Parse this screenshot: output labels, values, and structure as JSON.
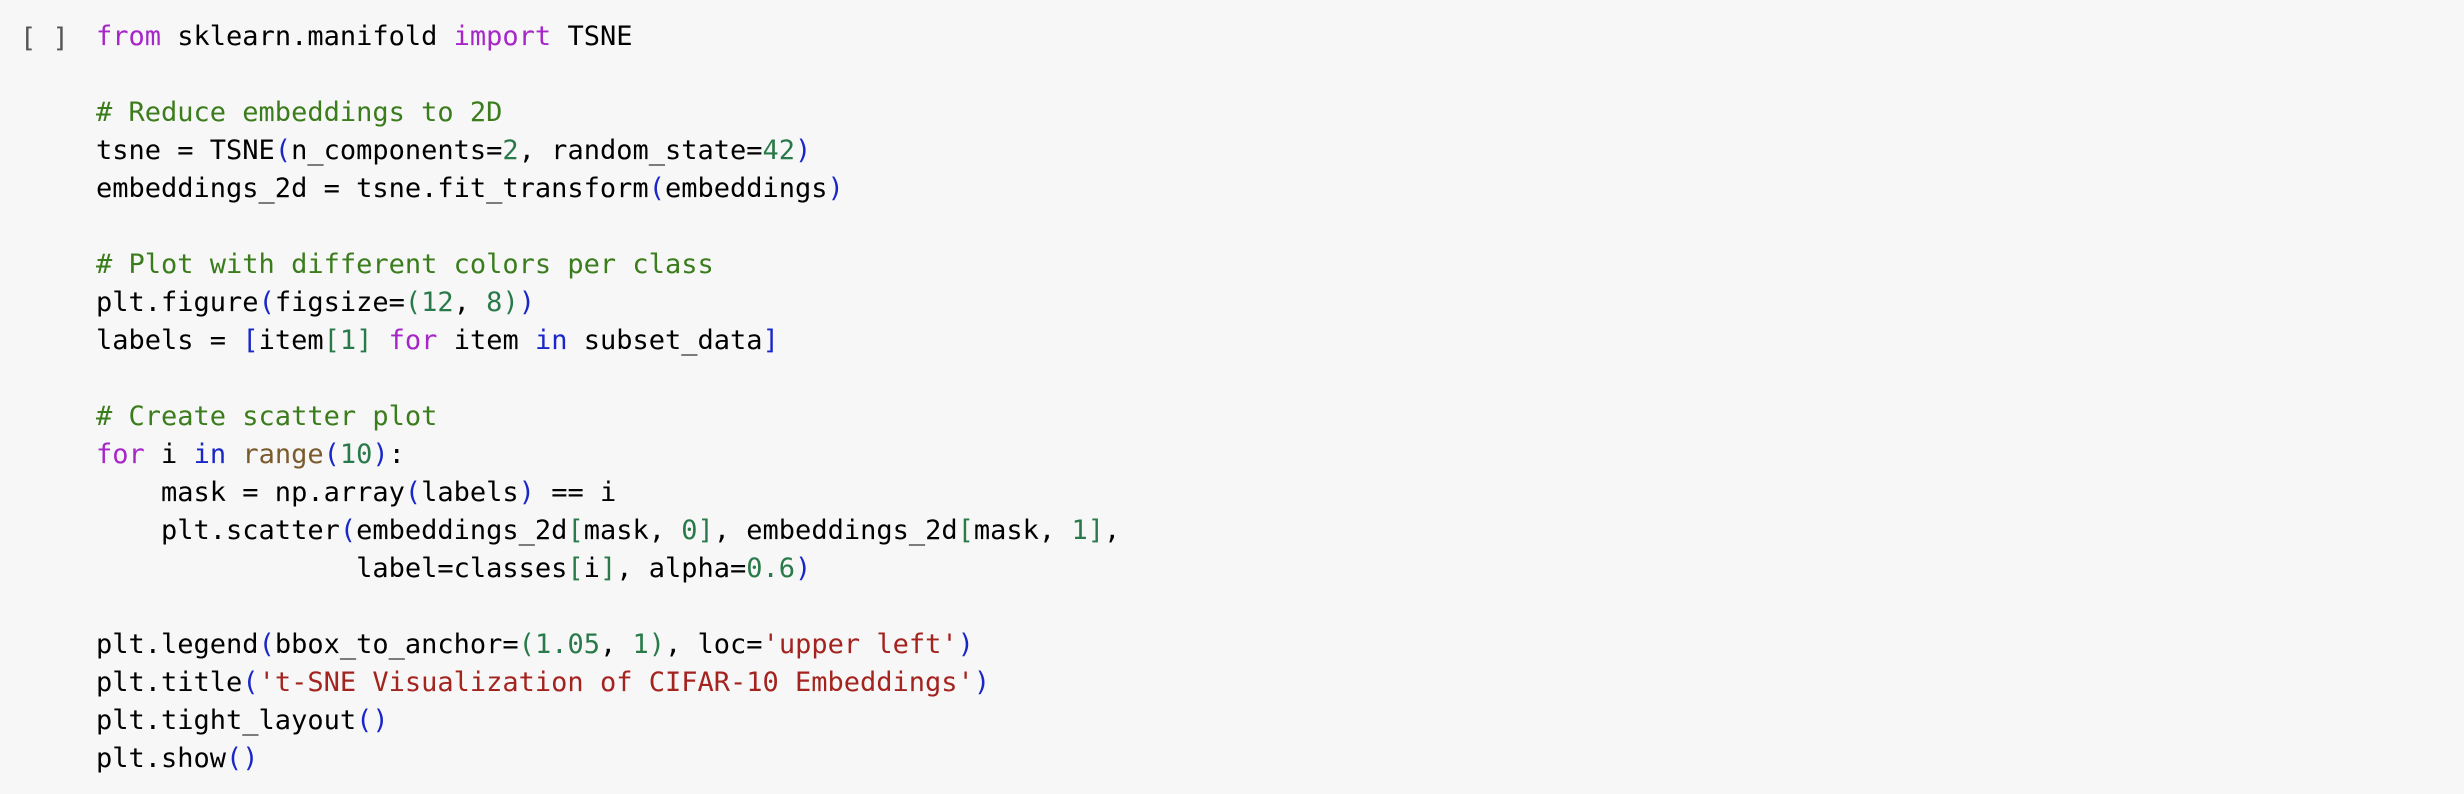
{
  "cell": {
    "run_indicator": "[ ]",
    "lines": [
      [
        {
          "t": "from",
          "c": "kw"
        },
        {
          "t": " sklearn.manifold ",
          "c": "id"
        },
        {
          "t": "import",
          "c": "kw"
        },
        {
          "t": " TSNE",
          "c": "id"
        }
      ],
      [],
      [
        {
          "t": "# Reduce embeddings to 2D",
          "c": "cm"
        }
      ],
      [
        {
          "t": "tsne = TSNE",
          "c": "id"
        },
        {
          "t": "(",
          "c": "br"
        },
        {
          "t": "n_components=",
          "c": "id"
        },
        {
          "t": "2",
          "c": "num"
        },
        {
          "t": ", random_state=",
          "c": "id"
        },
        {
          "t": "42",
          "c": "num"
        },
        {
          "t": ")",
          "c": "br"
        }
      ],
      [
        {
          "t": "embeddings_2d = tsne.fit_transform",
          "c": "id"
        },
        {
          "t": "(",
          "c": "br"
        },
        {
          "t": "embeddings",
          "c": "id"
        },
        {
          "t": ")",
          "c": "br"
        }
      ],
      [],
      [
        {
          "t": "# Plot with different colors per class",
          "c": "cm"
        }
      ],
      [
        {
          "t": "plt.figure",
          "c": "id"
        },
        {
          "t": "(",
          "c": "br"
        },
        {
          "t": "figsize=",
          "c": "id"
        },
        {
          "t": "(",
          "c": "num"
        },
        {
          "t": "12",
          "c": "num"
        },
        {
          "t": ", ",
          "c": "id"
        },
        {
          "t": "8",
          "c": "num"
        },
        {
          "t": ")",
          "c": "num"
        },
        {
          "t": ")",
          "c": "br"
        }
      ],
      [
        {
          "t": "labels = ",
          "c": "id"
        },
        {
          "t": "[",
          "c": "br"
        },
        {
          "t": "item",
          "c": "id"
        },
        {
          "t": "[1]",
          "c": "num"
        },
        {
          "t": " ",
          "c": "id"
        },
        {
          "t": "for",
          "c": "kw"
        },
        {
          "t": " item ",
          "c": "id"
        },
        {
          "t": "in",
          "c": "kw2"
        },
        {
          "t": " subset_data",
          "c": "id"
        },
        {
          "t": "]",
          "c": "br"
        }
      ],
      [],
      [
        {
          "t": "# Create scatter plot",
          "c": "cm"
        }
      ],
      [
        {
          "t": "for",
          "c": "kw"
        },
        {
          "t": " i ",
          "c": "id"
        },
        {
          "t": "in",
          "c": "kw2"
        },
        {
          "t": " ",
          "c": "id"
        },
        {
          "t": "range",
          "c": "fn"
        },
        {
          "t": "(",
          "c": "br"
        },
        {
          "t": "10",
          "c": "num"
        },
        {
          "t": ")",
          "c": "br"
        },
        {
          "t": ":",
          "c": "id"
        }
      ],
      [
        {
          "t": "    mask = np.array",
          "c": "id"
        },
        {
          "t": "(",
          "c": "br"
        },
        {
          "t": "labels",
          "c": "id"
        },
        {
          "t": ")",
          "c": "br"
        },
        {
          "t": " == i",
          "c": "id"
        }
      ],
      [
        {
          "t": "    plt.scatter",
          "c": "id"
        },
        {
          "t": "(",
          "c": "br"
        },
        {
          "t": "embeddings_2d",
          "c": "id"
        },
        {
          "t": "[",
          "c": "num"
        },
        {
          "t": "mask, ",
          "c": "id"
        },
        {
          "t": "0",
          "c": "num"
        },
        {
          "t": "]",
          "c": "num"
        },
        {
          "t": ", embeddings_2d",
          "c": "id"
        },
        {
          "t": "[",
          "c": "num"
        },
        {
          "t": "mask, ",
          "c": "id"
        },
        {
          "t": "1",
          "c": "num"
        },
        {
          "t": "]",
          "c": "num"
        },
        {
          "t": ",",
          "c": "id"
        }
      ],
      [
        {
          "t": "                label=classes",
          "c": "id"
        },
        {
          "t": "[",
          "c": "num"
        },
        {
          "t": "i",
          "c": "id"
        },
        {
          "t": "]",
          "c": "num"
        },
        {
          "t": ", alpha=",
          "c": "id"
        },
        {
          "t": "0.6",
          "c": "num"
        },
        {
          "t": ")",
          "c": "br"
        }
      ],
      [],
      [
        {
          "t": "plt.legend",
          "c": "id"
        },
        {
          "t": "(",
          "c": "br"
        },
        {
          "t": "bbox_to_anchor=",
          "c": "id"
        },
        {
          "t": "(",
          "c": "num"
        },
        {
          "t": "1.05",
          "c": "num"
        },
        {
          "t": ", ",
          "c": "id"
        },
        {
          "t": "1",
          "c": "num"
        },
        {
          "t": ")",
          "c": "num"
        },
        {
          "t": ", loc=",
          "c": "id"
        },
        {
          "t": "'upper left'",
          "c": "str"
        },
        {
          "t": ")",
          "c": "br"
        }
      ],
      [
        {
          "t": "plt.title",
          "c": "id"
        },
        {
          "t": "(",
          "c": "br"
        },
        {
          "t": "'t-SNE Visualization of CIFAR-10 Embeddings'",
          "c": "str"
        },
        {
          "t": ")",
          "c": "br"
        }
      ],
      [
        {
          "t": "plt.tight_layout",
          "c": "id"
        },
        {
          "t": "()",
          "c": "br"
        }
      ],
      [
        {
          "t": "plt.show",
          "c": "id"
        },
        {
          "t": "()",
          "c": "br"
        }
      ]
    ]
  }
}
